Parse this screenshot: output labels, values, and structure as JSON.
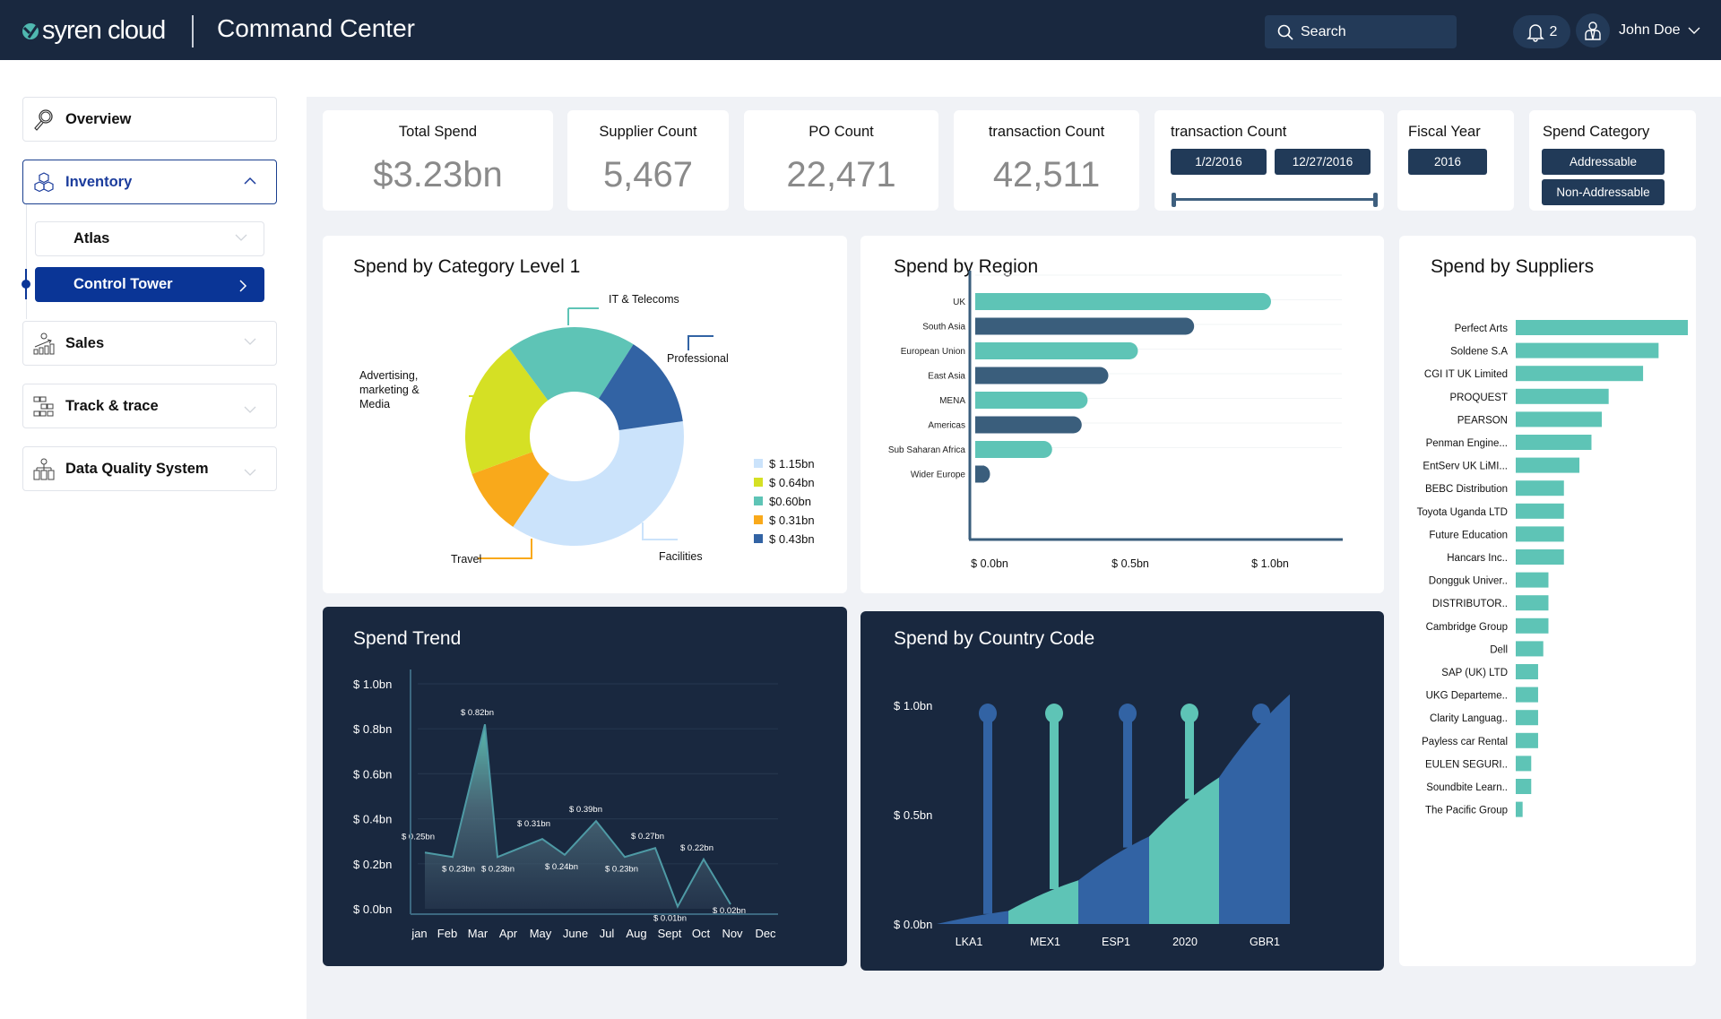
{
  "header": {
    "logo_text": "syren cloud",
    "app_title": "Command Center",
    "search_placeholder": "Search",
    "notification_count": "2",
    "user_name": "John Doe"
  },
  "sidebar": {
    "items": [
      {
        "label": "Overview",
        "icon": "magnifier-icon"
      },
      {
        "label": "Inventory",
        "icon": "cubes-icon",
        "expanded": true
      },
      {
        "label": "Sales",
        "icon": "sales-growth-icon"
      },
      {
        "label": "Track & trace",
        "icon": "flow-blocks-icon"
      },
      {
        "label": "Data Quality System",
        "icon": "hierarchy-icon"
      }
    ],
    "inventory_children": [
      {
        "label": "Atlas",
        "active": false
      },
      {
        "label": "Control Tower",
        "active": true
      }
    ]
  },
  "kpis": [
    {
      "label": "Total Spend",
      "value": "$3.23bn"
    },
    {
      "label": "Supplier Count",
      "value": "5,467"
    },
    {
      "label": "PO Count",
      "value": "22,471"
    },
    {
      "label": "transaction Count",
      "value": "42,511"
    }
  ],
  "filters": {
    "date_range": {
      "label": "transaction Count",
      "start": "1/2/2016",
      "end": "12/27/2016",
      "slider_start_fraction": 0,
      "slider_end_fraction": 1
    },
    "fiscal_year": {
      "label": "Fiscal Year",
      "value": "2016"
    },
    "spend_category": {
      "label": "Spend Category",
      "options": [
        "Addressable",
        "Non-Addressable"
      ]
    }
  },
  "colors": {
    "navy": "#19283f",
    "teal": "#5ec4b6",
    "slate_blue": "#3a5e7c",
    "royal_blue": "#3263a4",
    "active_blue": "#0a3596",
    "light_blue": "#cbe3fb",
    "lime": "#d5e024",
    "orange": "#f9a91b"
  },
  "chart_data": [
    {
      "id": "category",
      "type": "pie",
      "title": "Spend by Category Level 1",
      "donut": true,
      "slices": [
        {
          "label": "Facilities",
          "value": 1.15,
          "legend": "$ 1.15bn",
          "color": "#cbe3fb"
        },
        {
          "label": "Travel",
          "value": 0.31,
          "legend": "$ 0.31bn",
          "color": "#f9a91b"
        },
        {
          "label": "Advertising, marketing & Media",
          "value": 0.64,
          "legend": "$ 0.64bn",
          "color": "#d5e024"
        },
        {
          "label": "IT & Telecoms",
          "value": 0.6,
          "legend": "$0.60bn",
          "color": "#5ec4b6"
        },
        {
          "label": "Professional",
          "value": 0.43,
          "legend": "$ 0.43bn",
          "color": "#3263a4"
        }
      ],
      "legend_order": [
        "Facilities",
        "Advertising, marketing & Media",
        "IT & Telecoms",
        "Travel",
        "Professional"
      ],
      "legend_position": "right"
    },
    {
      "id": "region",
      "type": "bar",
      "orientation": "horizontal",
      "title": "Spend by Region",
      "categories": [
        "UK",
        "South Asia",
        "European Union",
        "East Asia",
        "MENA",
        "Americas",
        "Sub Saharan Africa",
        "Wider Europe"
      ],
      "values": [
        1.0,
        0.74,
        0.55,
        0.45,
        0.38,
        0.36,
        0.26,
        0.05
      ],
      "unit": "bn",
      "xticks": [
        "$ 0.0bn",
        "$ 0.5bn",
        "$ 1.0bn"
      ],
      "xlim": [
        0,
        1.0
      ],
      "bar_colors": [
        "#5ec4b6",
        "#3a5e7c"
      ]
    },
    {
      "id": "suppliers",
      "type": "bar",
      "orientation": "horizontal",
      "title": "Spend by Suppliers",
      "categories": [
        "Perfect Arts",
        "Soldene S.A",
        "CGI IT UK Limited",
        "PROQUEST",
        "PEARSON",
        "Penman Engine...",
        "EntServ UK LiMI...",
        "BEBC Distribution",
        "Toyota Uganda LTD",
        "Future Education",
        "Hancars Inc..",
        "Dongguk Univer..",
        "DISTRIBUTOR..",
        "Cambridge Group",
        "Dell",
        "SAP (UK) LTD",
        "UKG Departeme..",
        "Clarity Languag..",
        "Payless car Rental",
        "EULEN SEGURI..",
        "Soundbite Learn..",
        "The Pacific Group"
      ],
      "values": [
        100,
        83,
        74,
        54,
        50,
        44,
        37,
        28,
        28,
        28,
        28,
        19,
        19,
        19,
        16,
        13,
        13,
        13,
        13,
        9,
        9,
        4
      ],
      "unit": "relative (max = 100)",
      "color": "#5ec4b6"
    },
    {
      "id": "trend",
      "type": "area",
      "title": "Spend Trend",
      "categories": [
        "jan",
        "Feb",
        "Mar",
        "Apr",
        "May",
        "June",
        "Jul",
        "Aug",
        "Sept",
        "Oct",
        "Nov",
        "Dec"
      ],
      "values": [
        0.25,
        0.23,
        0.82,
        0.23,
        0.31,
        0.24,
        0.39,
        0.23,
        0.27,
        0.01,
        0.22,
        0.02
      ],
      "labels": [
        "$ 0.25bn",
        "$ 0.23bn",
        "$ 0.82bn",
        "$ 0.23bn",
        "$ 0.31bn",
        "$ 0.24bn",
        "$ 0.39bn",
        "$ 0.23bn",
        "$ 0.27bn",
        "$ 0.01bn",
        "$ 0.22bn",
        "$ 0.02bn"
      ],
      "yticks": [
        "$ 0.0bn",
        "$ 0.2bn",
        "$ 0.4bn",
        "$ 0.6bn",
        "$ 0.8bn",
        "$ 1.0bn"
      ],
      "ylim": [
        0,
        1.0
      ],
      "grid": true
    },
    {
      "id": "country",
      "type": "area",
      "title": "Spend by Country Code",
      "categories": [
        "LKA1",
        "MEX1",
        "ESP1",
        "2020",
        "GBR1"
      ],
      "stem_values": [
        1.0,
        1.0,
        1.0,
        1.0,
        1.0
      ],
      "area_curve": [
        0.0,
        0.06,
        0.2,
        0.4,
        0.67,
        1.05
      ],
      "yticks": [
        "$ 0.0bn",
        "$ 0.5bn",
        "$ 1.0bn"
      ],
      "ylim": [
        0,
        1.0
      ],
      "colors": [
        "#3263a4",
        "#5ec4b6",
        "#3263a4",
        "#5ec4b6",
        "#3263a4"
      ]
    }
  ]
}
